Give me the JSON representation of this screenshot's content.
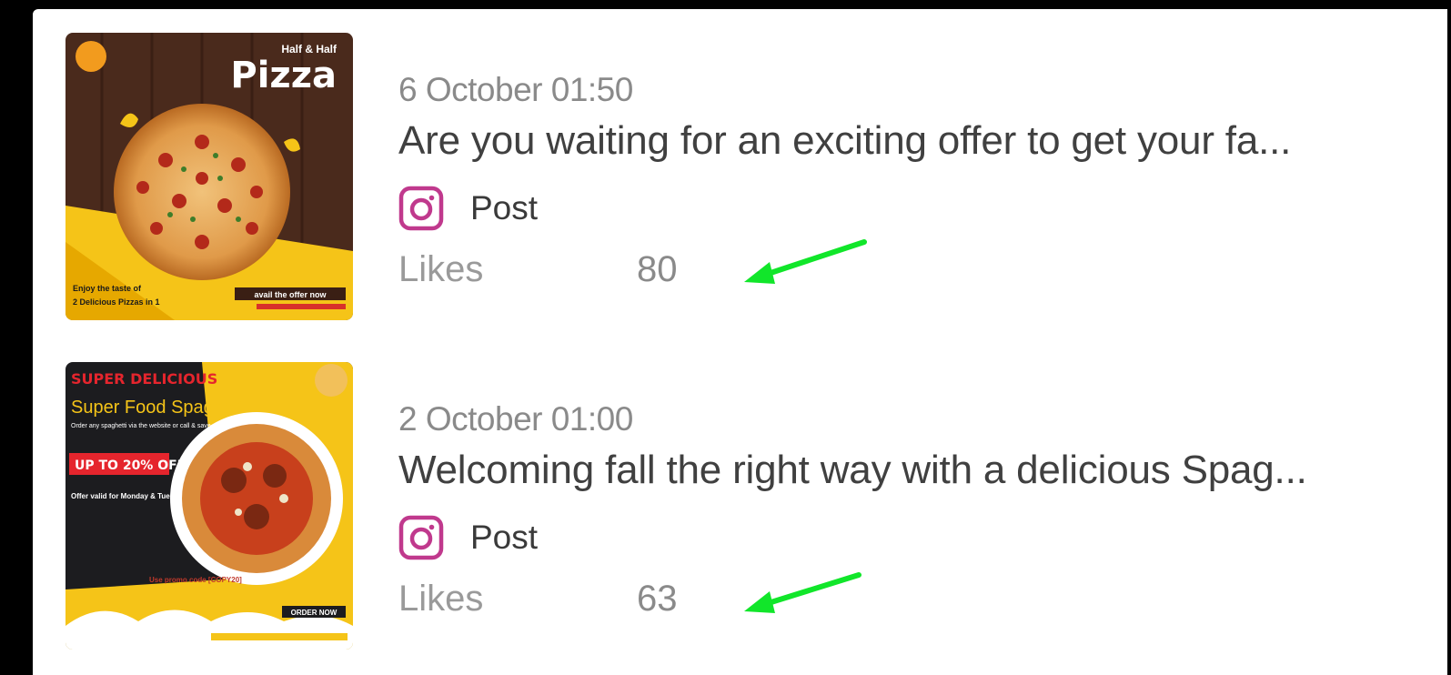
{
  "posts": [
    {
      "date": "6 October 01:50",
      "caption": "Are you waiting for an exciting offer to get your fa...",
      "platform_icon": "instagram-icon",
      "type": "Post",
      "likes_label": "Likes",
      "likes": "80",
      "thumbnail": {
        "title": "Pizza",
        "badge": "Half & Half",
        "footer_left_1": "Enjoy the taste of",
        "footer_left_2": "2 Delicious Pizzas in 1",
        "footer_right": "avail the offer now"
      }
    },
    {
      "date": "2 October 01:00",
      "caption": "Welcoming fall the right way with a delicious Spag...",
      "platform_icon": "instagram-icon",
      "type": "Post",
      "likes_label": "Likes",
      "likes": "63",
      "thumbnail": {
        "kicker": "SUPER DELICIOUS",
        "title": "Super Food Spaghetti",
        "sub": "Order any spaghetti via the website or call & save",
        "discount": "UP TO 20% OFF",
        "offer": "Offer valid for Monday & Tuesday Only",
        "promo": "Use promo code [COPY20]",
        "cta": "ORDER NOW"
      }
    }
  ],
  "colors": {
    "instagram": "#c0398d",
    "annotation_arrow": "#11e62a",
    "date_text": "#8a8a8a",
    "caption_text": "#404040"
  }
}
